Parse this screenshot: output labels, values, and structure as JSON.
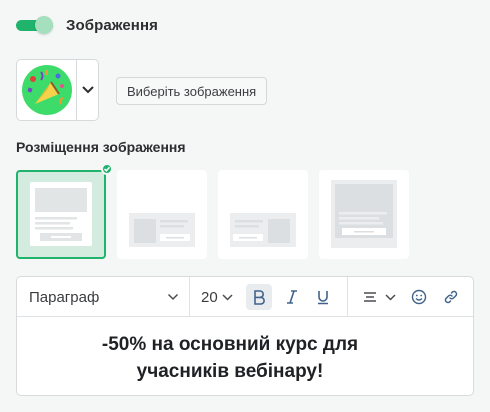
{
  "image_section": {
    "toggle_label": "Зображення",
    "toggle_on": true,
    "choose_button_label": "Виберіть зображення"
  },
  "placement": {
    "title": "Розміщення зображення",
    "options": [
      "image-top",
      "image-left",
      "image-right",
      "image-background"
    ],
    "selected": "image-top"
  },
  "editor": {
    "style_select": "Параграф",
    "font_size": "20",
    "content_line1": "-50% на основний курс для",
    "content_line2": "учасників вебінару!"
  },
  "colors": {
    "accent": "#1fb36b",
    "selected_bg": "#d4ece0",
    "placeholder": "#e2e5e6"
  }
}
